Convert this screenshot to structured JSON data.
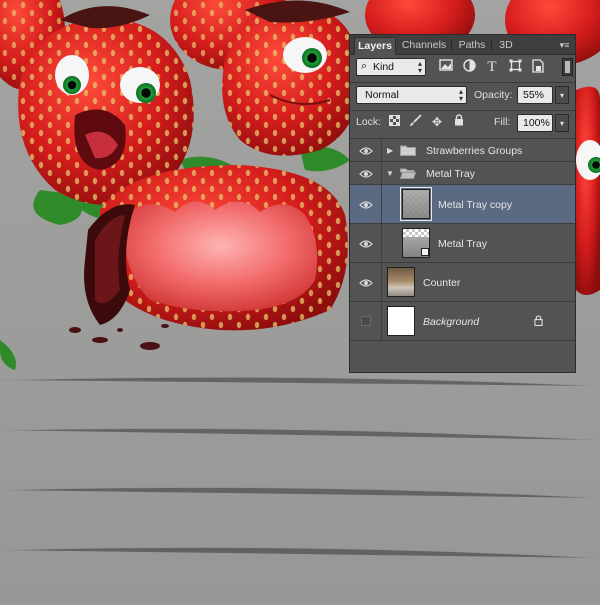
{
  "panel": {
    "tabs": [
      {
        "label": "Layers",
        "active": true
      },
      {
        "label": "Channels",
        "active": false
      },
      {
        "label": "Paths",
        "active": false
      },
      {
        "label": "3D",
        "active": false
      }
    ],
    "menu_icon": "panel-menu-icon",
    "filter": {
      "kind_label": "Kind",
      "icons": [
        "pixel-filter-icon",
        "adjustment-filter-icon",
        "type-filter-icon",
        "shape-filter-icon",
        "smart-object-filter-icon"
      ]
    },
    "blend_mode": "Normal",
    "opacity_label": "Opacity:",
    "opacity_value": "55%",
    "lock_label": "Lock:",
    "fill_label": "Fill:",
    "fill_value": "100%",
    "lock_icons": [
      "lock-transparent-pixels-icon",
      "lock-image-pixels-icon",
      "lock-position-icon",
      "lock-all-icon"
    ],
    "layers": [
      {
        "name": "Strawberries Groups",
        "type": "group",
        "expanded": false,
        "visible": true,
        "selected": false
      },
      {
        "name": "Metal Tray",
        "type": "group",
        "expanded": true,
        "visible": true,
        "selected": false
      },
      {
        "name": "Metal Tray copy",
        "type": "layer",
        "visible": true,
        "selected": true,
        "indented": true
      },
      {
        "name": "Metal Tray",
        "type": "smart-object",
        "visible": true,
        "selected": false,
        "indented": true
      },
      {
        "name": "Counter",
        "type": "layer",
        "visible": true,
        "selected": false
      },
      {
        "name": "Background",
        "type": "background",
        "visible": false,
        "selected": false,
        "locked": true
      }
    ]
  },
  "colors": {
    "panel_bg": "#535353",
    "tab_bar_bg": "#3f3f3f",
    "selected_row": "#5a6a82",
    "counter_surface": "#9c9c9a",
    "strawberry_red": "#d41f1f",
    "eye_green": "#1fa43a"
  }
}
